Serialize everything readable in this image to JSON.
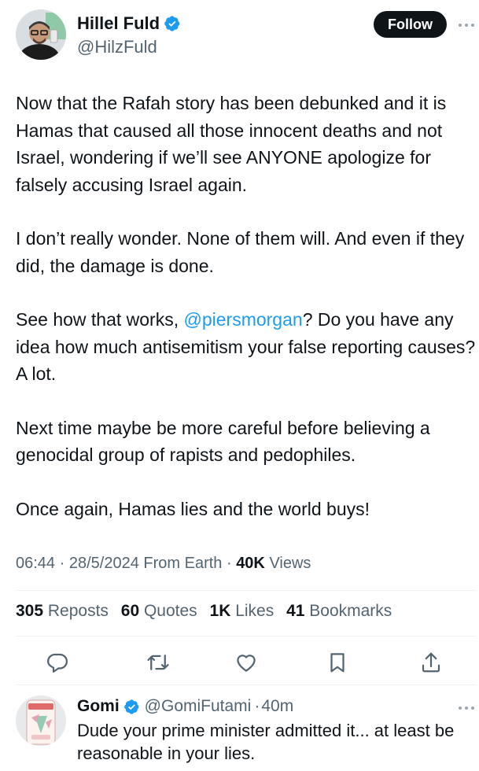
{
  "tweet": {
    "author": {
      "name": "Hillel Fuld",
      "handle": "@HilzFuld",
      "verified": true
    },
    "follow_label": "Follow",
    "body": {
      "p1": "Now that the Rafah story has been  debunked and it is Hamas that caused all those innocent deaths and not Israel, wondering if we’ll see ANYONE apologize for falsely accusing Israel again.",
      "p2": "I don’t really wonder. None of them will. And even if they did, the damage is done.",
      "p3_before": "See how that works, ",
      "p3_mention": "@piersmorgan",
      "p3_after": "? Do you have any idea how much antisemitism your false reporting causes? A lot.",
      "p4": "Next time maybe be more careful before believing a genocidal group of rapists and pedophiles.",
      "p5": "Once again, Hamas lies and the world buys!"
    },
    "meta": {
      "time": "06:44",
      "sep1": " · ",
      "date": "28/5/2024",
      "source": " From Earth",
      "sep2": " · ",
      "views_count": "40K",
      "views_label": " Views"
    },
    "stats": {
      "reposts_count": "305",
      "reposts_label": " Reposts",
      "quotes_count": "60",
      "quotes_label": " Quotes",
      "likes_count": "1K",
      "likes_label": " Likes",
      "bookmarks_count": "41",
      "bookmarks_label": " Bookmarks"
    },
    "actions": [
      "reply-icon",
      "repost-icon",
      "like-icon",
      "bookmark-icon",
      "share-icon"
    ]
  },
  "reply": {
    "name": "Gomi",
    "handle": "@GomiFutami",
    "sep": "·",
    "time": "40m",
    "verified": true,
    "text": "Dude your prime minister admitted it... at least be reasonable in your lies."
  },
  "colors": {
    "accent": "#1d9bf0",
    "text": "#0f1419",
    "muted": "#536471",
    "divider": "#eff3f4"
  }
}
